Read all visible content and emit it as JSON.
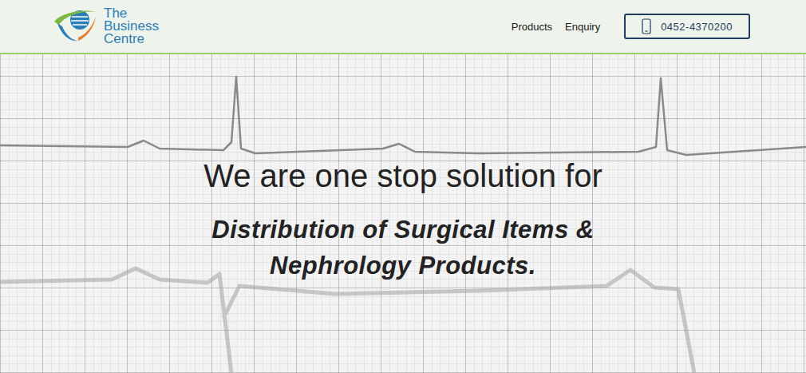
{
  "brand": {
    "lines": [
      "The",
      "Business",
      "Centre"
    ]
  },
  "nav": {
    "items": [
      "Products",
      "Enquiry"
    ],
    "phone": "0452-4370200"
  },
  "hero": {
    "heading": "We are one stop solution for",
    "lines": [
      "Distribution of Surgical Items &",
      "Nephrology Products."
    ]
  }
}
